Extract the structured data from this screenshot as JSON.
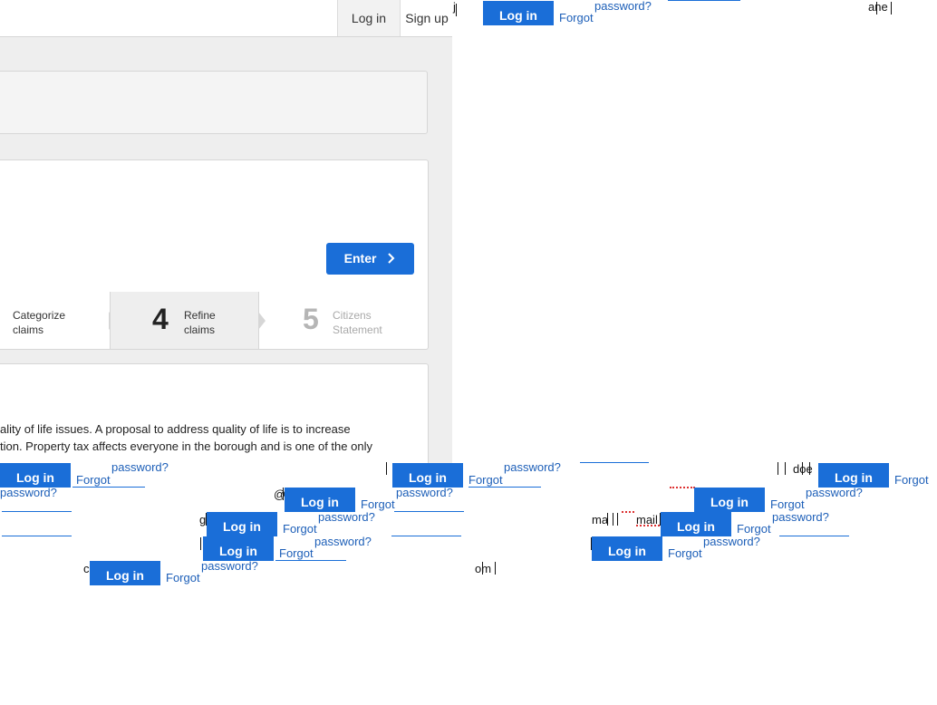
{
  "nav": {
    "login": "Log in",
    "signup": "Sign up"
  },
  "enter_label": "Enter",
  "steps": [
    {
      "label1": "Categorize",
      "label2": "claims"
    },
    {
      "number": "4",
      "label1": "Refine",
      "label2": "claims"
    },
    {
      "number": "5",
      "label1": "Citizens",
      "label2": "Statement"
    }
  ],
  "statement": [
    "ality of life issues. A proposal to address quality of life is to increase",
    "tion. Property tax affects everyone in the borough and is one of the only"
  ],
  "widget": {
    "login": "Log in",
    "forgot": "Forgot",
    "password": "password?"
  },
  "fragments": {
    "a": "j",
    "b": "ane",
    "c": "doe",
    "d": "@",
    "e": "g",
    "f": "ma",
    "g": "mail",
    "h": "c",
    "i": "om"
  },
  "colors": {
    "accent": "#1a6ed8",
    "link": "#1d5fb8",
    "panel": "#eeeeee"
  }
}
